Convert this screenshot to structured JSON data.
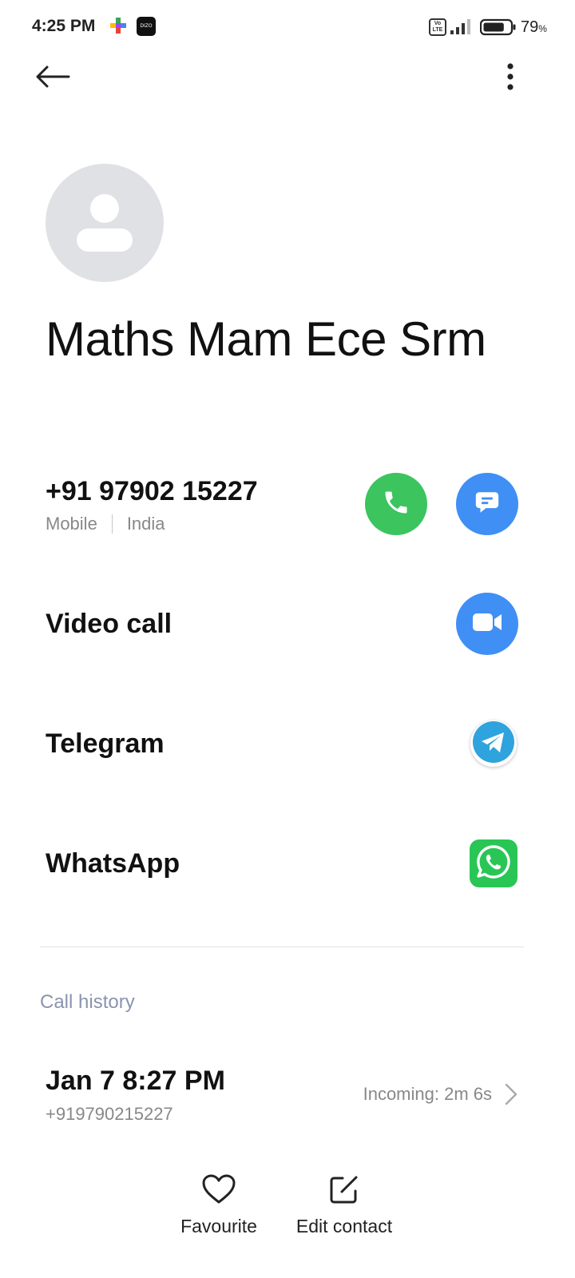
{
  "status_bar": {
    "time": "4:25 PM",
    "app_icon_2_text": "DIZO",
    "volte_text": "Vo LTE",
    "battery_percent": "79",
    "battery_unit": "%",
    "battery_level": 0.79
  },
  "contact": {
    "name": "Maths Mam Ece Srm"
  },
  "phone": {
    "number": "+91 97902 15227",
    "type": "Mobile",
    "region": "India"
  },
  "rows": {
    "video_call": "Video call",
    "telegram": "Telegram",
    "whatsapp": "WhatsApp"
  },
  "call_history": {
    "title": "Call history",
    "entries": [
      {
        "date": "Jan 7 8:27 PM",
        "number": "+919790215227",
        "status": "Incoming: 2m 6s"
      }
    ]
  },
  "bottom_actions": {
    "favourite": "Favourite",
    "edit_contact": "Edit contact"
  },
  "colors": {
    "call_green": "#3cc45f",
    "message_blue": "#3f8ff5",
    "whatsapp_green": "#29c656",
    "telegram_blue": "#2fa3de",
    "avatar_gray": "#dfe1e5",
    "section_title": "#8a94ae"
  },
  "icons": [
    "back-arrow-icon",
    "more-vert-icon",
    "person-icon",
    "phone-icon",
    "message-icon",
    "video-camera-icon",
    "telegram-icon",
    "whatsapp-icon",
    "chevron-right-icon",
    "heart-icon",
    "edit-icon"
  ]
}
